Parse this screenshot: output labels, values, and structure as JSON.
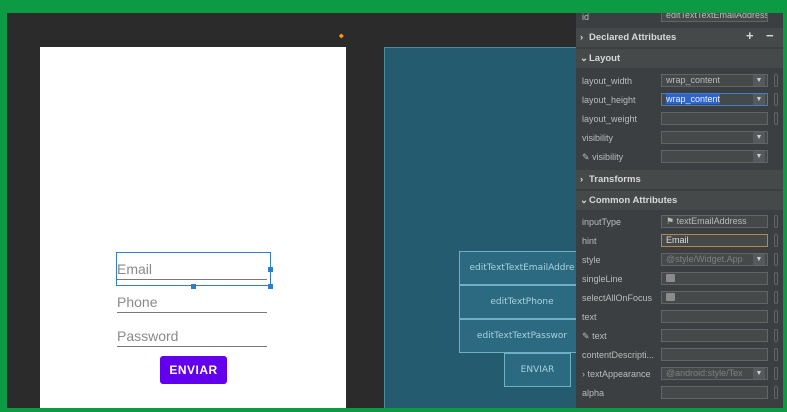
{
  "preview": {
    "fields": {
      "email": "Email",
      "phone": "Phone",
      "password": "Password"
    },
    "button": "ENVIAR"
  },
  "blueprint": {
    "email": "editTextTextEmailAddre",
    "phone": "editTextPhone",
    "password": "editTextTextPasswor",
    "button": "ENVIAR"
  },
  "attributes": {
    "id": {
      "label": "id",
      "value": "editTextTextEmailAddress"
    },
    "declared": {
      "title": "Declared Attributes",
      "add": "+",
      "remove": "−"
    },
    "layout": {
      "title": "Layout",
      "rows": [
        {
          "label": "layout_width",
          "value": "wrap_content"
        },
        {
          "label": "layout_height",
          "value": "wrap_content"
        },
        {
          "label": "layout_weight",
          "value": ""
        },
        {
          "label": "visibility",
          "value": ""
        },
        {
          "label": "visibility",
          "value": ""
        }
      ]
    },
    "transforms": {
      "title": "Transforms"
    },
    "common": {
      "title": "Common Attributes",
      "rows": [
        {
          "label": "inputType",
          "value": "textEmailAddress"
        },
        {
          "label": "hint",
          "value": "Email"
        },
        {
          "label": "style",
          "value": "@style/Widget.App"
        },
        {
          "label": "singleLine",
          "value": ""
        },
        {
          "label": "selectAllOnFocus",
          "value": ""
        },
        {
          "label": "text",
          "value": ""
        },
        {
          "label": "text",
          "value": ""
        },
        {
          "label": "contentDescripti...",
          "value": ""
        },
        {
          "label": "textAppearance",
          "value": "@android:style/Tex"
        },
        {
          "label": "alpha",
          "value": ""
        }
      ]
    }
  },
  "colors": {
    "accent": "#6200ee",
    "selection": "#2f7ec7",
    "frame": "#0c9a45"
  }
}
